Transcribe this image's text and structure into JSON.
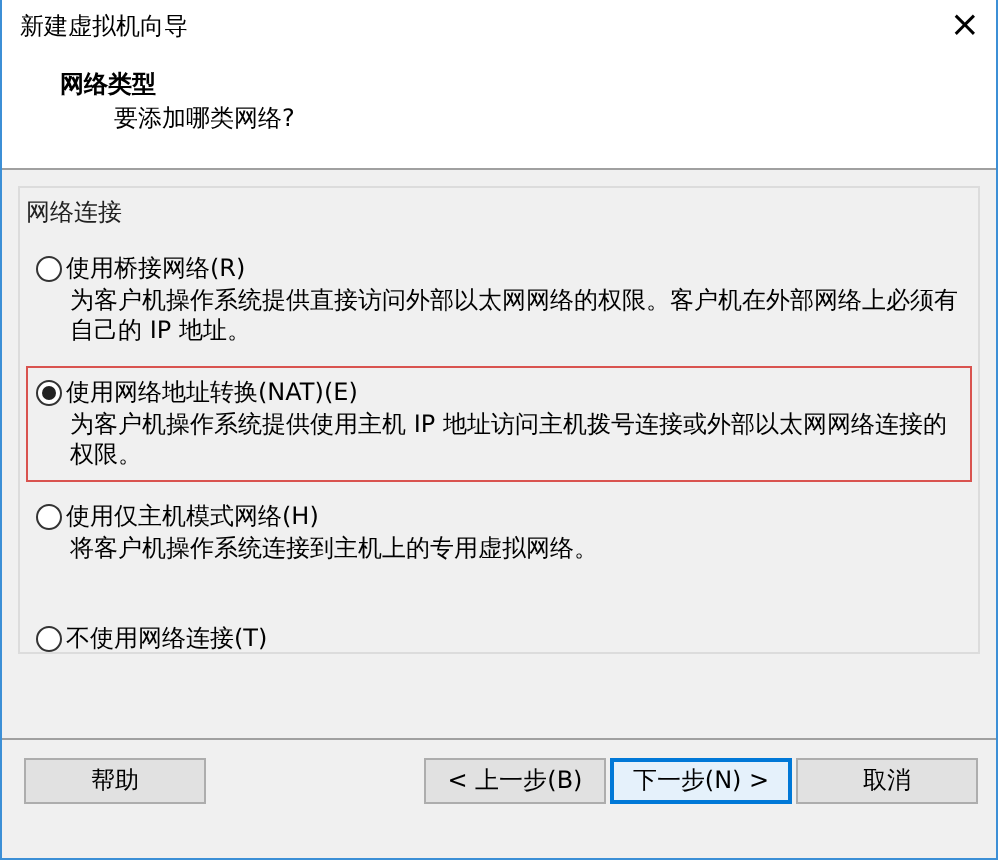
{
  "window": {
    "title": "新建虚拟机向导",
    "close": "×"
  },
  "header": {
    "title": "网络类型",
    "subtitle": "要添加哪类网络?"
  },
  "group": {
    "title": "网络连接",
    "options": [
      {
        "label": "使用桥接网络(R)",
        "description": "为客户机操作系统提供直接访问外部以太网网络的权限。客户机在外部网络上必须有自己的 IP 地址。",
        "selected": false,
        "highlighted": false
      },
      {
        "label": "使用网络地址转换(NAT)(E)",
        "description": "为客户机操作系统提供使用主机 IP 地址访问主机拨号连接或外部以太网网络连接的权限。",
        "selected": true,
        "highlighted": true
      },
      {
        "label": "使用仅主机模式网络(H)",
        "description": "将客户机操作系统连接到主机上的专用虚拟网络。",
        "selected": false,
        "highlighted": false
      },
      {
        "label": "不使用网络连接(T)",
        "selected": false,
        "highlighted": false
      }
    ]
  },
  "buttons": [
    {
      "label": "帮助",
      "kind": "left",
      "focused": false
    },
    {
      "label": "< 上一步(B)",
      "kind": "right",
      "focused": false
    },
    {
      "label": "下一步(N) >",
      "kind": "right",
      "focused": true
    },
    {
      "label": "取消",
      "kind": "right",
      "focused": false
    }
  ]
}
